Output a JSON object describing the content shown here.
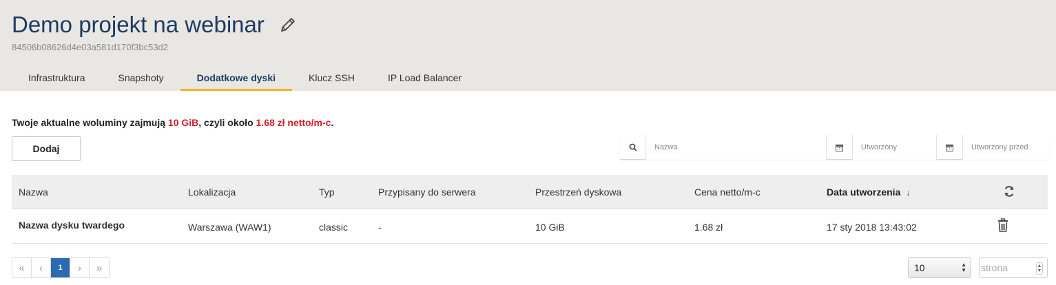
{
  "project": {
    "title": "Demo projekt na webinar",
    "id": "84506b08626d4e03a581d170f3bc53d2"
  },
  "tabs": [
    {
      "label": "Infrastruktura",
      "active": false
    },
    {
      "label": "Snapshoty",
      "active": false
    },
    {
      "label": "Dodatkowe dyski",
      "active": true
    },
    {
      "label": "Klucz SSH",
      "active": false
    },
    {
      "label": "IP Load Balancer",
      "active": false
    }
  ],
  "summary": {
    "prefix": "Twoje aktualne woluminy zajmują ",
    "size": "10 GiB",
    "middle": ", czyli około ",
    "price": "1.68 zł netto/m-c",
    "suffix": "."
  },
  "actions": {
    "add_label": "Dodaj"
  },
  "filters": {
    "name_placeholder": "Nazwa",
    "created_placeholder": "Utworzony",
    "created_before_placeholder": "Utworzony przed"
  },
  "table": {
    "headers": {
      "name": "Nazwa",
      "location": "Lokalizacja",
      "type": "Typ",
      "server": "Przypisany do serwera",
      "space": "Przestrzeń dyskowa",
      "price": "Cena netto/m-c",
      "created": "Data utworzenia"
    },
    "rows": [
      {
        "name": "Nazwa dysku twardego",
        "location": "Warszawa (WAW1)",
        "type": "classic",
        "server": "-",
        "space": "10 GiB",
        "price": "1.68 zł",
        "created": "17 sty 2018 13:43:02"
      }
    ]
  },
  "pagination": {
    "first": "«",
    "prev": "‹",
    "current": "1",
    "next": "›",
    "last": "»",
    "per_page": "10",
    "page_placeholder": "strona"
  },
  "colors": {
    "title": "#1f3a5f",
    "accent_tab": "#f0b323",
    "highlight_red": "#d0202f",
    "pager_active": "#2a6bb0",
    "header_bg": "#e8e7e3"
  },
  "icons": {
    "edit": "pencil-icon",
    "search": "search-icon",
    "calendar": "calendar-icon",
    "refresh": "refresh-icon",
    "delete": "trash-icon",
    "sort": "arrow-down-icon"
  }
}
